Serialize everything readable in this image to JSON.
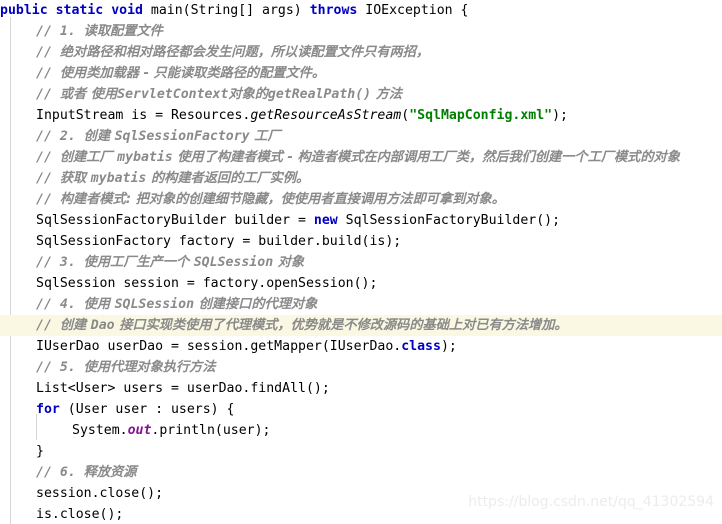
{
  "editor": {
    "background_color": "#ffffff",
    "highlight_line_color": "#faf8e3",
    "indent_guide_color": "#d6d6d6",
    "colors": {
      "keyword": "#0000c0",
      "string": "#008000",
      "comment": "#959595",
      "static_field": "#871094",
      "plain": "#000000"
    },
    "watermark": "https://blog.csdn.net/qq_41302594",
    "lines": [
      {
        "index": 1,
        "indent": 0,
        "highlighted": false,
        "text": "public static void main(String[] args) throws IOException {",
        "tokens": [
          {
            "t": "public",
            "k": "kw"
          },
          {
            "t": " ",
            "k": "pln"
          },
          {
            "t": "static",
            "k": "kw"
          },
          {
            "t": " ",
            "k": "pln"
          },
          {
            "t": "void",
            "k": "kw"
          },
          {
            "t": " main(String[] args) ",
            "k": "pln"
          },
          {
            "t": "throws",
            "k": "kw"
          },
          {
            "t": " IOException {",
            "k": "pln"
          }
        ]
      },
      {
        "index": 2,
        "indent": 1,
        "highlighted": false,
        "text": "// 1. 读取配置文件",
        "tokens": [
          {
            "t": "// 1. ",
            "k": "cmt-b"
          },
          {
            "t": "读取配置文件",
            "k": "cmt-cjk"
          }
        ]
      },
      {
        "index": 3,
        "indent": 1,
        "highlighted": false,
        "text": "// 绝对路径和相对路径都会发生问题，所以读配置文件只有两招，",
        "tokens": [
          {
            "t": "// ",
            "k": "cmt-b"
          },
          {
            "t": "绝对路径和相对路径都会发生问题，所以读配置文件只有两招，",
            "k": "cmt-cjk"
          }
        ]
      },
      {
        "index": 4,
        "indent": 1,
        "highlighted": false,
        "text": "// 使用类加载器 - 只能读取类路径的配置文件。",
        "tokens": [
          {
            "t": "// ",
            "k": "cmt-b"
          },
          {
            "t": "使用类加载器 - 只能读取类路径的配置文件。",
            "k": "cmt-cjk"
          }
        ]
      },
      {
        "index": 5,
        "indent": 1,
        "highlighted": false,
        "text": "// 或者 使用ServletContext对象的getRealPath() 方法",
        "tokens": [
          {
            "t": "// ",
            "k": "cmt-b"
          },
          {
            "t": "或者 使用",
            "k": "cmt-cjk"
          },
          {
            "t": "ServletContext",
            "k": "cmt-b"
          },
          {
            "t": "对象的",
            "k": "cmt-cjk"
          },
          {
            "t": "getRealPath()",
            "k": "cmt-b"
          },
          {
            "t": " 方法",
            "k": "cmt-cjk"
          }
        ]
      },
      {
        "index": 6,
        "indent": 1,
        "highlighted": false,
        "text": "InputStream is = Resources.getResourceAsStream(\"SqlMapConfig.xml\");",
        "tokens": [
          {
            "t": "InputStream is = Resources.",
            "k": "pln"
          },
          {
            "t": "getResourceAsStream",
            "k": "mth"
          },
          {
            "t": "(",
            "k": "pln"
          },
          {
            "t": "\"SqlMapConfig.xml\"",
            "k": "str"
          },
          {
            "t": ");",
            "k": "pln"
          }
        ]
      },
      {
        "index": 7,
        "indent": 1,
        "highlighted": false,
        "text": "// 2. 创建 SqlSessionFactory 工厂",
        "tokens": [
          {
            "t": "// 2. ",
            "k": "cmt-b"
          },
          {
            "t": "创建 ",
            "k": "cmt-cjk"
          },
          {
            "t": "SqlSessionFactory",
            "k": "cmt-b"
          },
          {
            "t": " 工厂",
            "k": "cmt-cjk"
          }
        ]
      },
      {
        "index": 8,
        "indent": 1,
        "highlighted": false,
        "text": "// 创建工厂 mybatis 使用了构建者模式 - 构造者模式在内部调用工厂类，然后我们创建一个工厂模式的对象",
        "tokens": [
          {
            "t": "// ",
            "k": "cmt-b"
          },
          {
            "t": "创建工厂 ",
            "k": "cmt-cjk"
          },
          {
            "t": "mybatis",
            "k": "cmt-b"
          },
          {
            "t": " 使用了构建者模式 - 构造者模式在内部调用工厂类，然后我们创建一个工厂模式的对象",
            "k": "cmt-cjk"
          }
        ]
      },
      {
        "index": 9,
        "indent": 1,
        "highlighted": false,
        "text": "// 获取 mybatis 的构建者返回的工厂实例。",
        "tokens": [
          {
            "t": "// ",
            "k": "cmt-b"
          },
          {
            "t": "获取 ",
            "k": "cmt-cjk"
          },
          {
            "t": "mybatis",
            "k": "cmt-b"
          },
          {
            "t": " 的构建者返回的工厂实例。",
            "k": "cmt-cjk"
          }
        ]
      },
      {
        "index": 10,
        "indent": 1,
        "highlighted": false,
        "text": "// 构建者模式: 把对象的创建细节隐藏，使使用者直接调用方法即可拿到对象。",
        "tokens": [
          {
            "t": "// ",
            "k": "cmt-b"
          },
          {
            "t": "构建者模式: 把对象的创建细节隐藏，使使用者直接调用方法即可拿到对象。",
            "k": "cmt-cjk"
          }
        ]
      },
      {
        "index": 11,
        "indent": 1,
        "highlighted": false,
        "text": "SqlSessionFactoryBuilder builder = new SqlSessionFactoryBuilder();",
        "tokens": [
          {
            "t": "SqlSessionFactoryBuilder builder = ",
            "k": "pln"
          },
          {
            "t": "new",
            "k": "kw"
          },
          {
            "t": " SqlSessionFactoryBuilder();",
            "k": "pln"
          }
        ]
      },
      {
        "index": 12,
        "indent": 1,
        "highlighted": false,
        "text": "SqlSessionFactory factory = builder.build(is);",
        "tokens": [
          {
            "t": "SqlSessionFactory factory = builder.build(is);",
            "k": "pln"
          }
        ]
      },
      {
        "index": 13,
        "indent": 1,
        "highlighted": false,
        "text": "// 3. 使用工厂生产一个 SQLSession 对象",
        "tokens": [
          {
            "t": "// 3. ",
            "k": "cmt-b"
          },
          {
            "t": "使用工厂生产一个 ",
            "k": "cmt-cjk"
          },
          {
            "t": "SQLSession",
            "k": "cmt-b"
          },
          {
            "t": " 对象",
            "k": "cmt-cjk"
          }
        ]
      },
      {
        "index": 14,
        "indent": 1,
        "highlighted": false,
        "text": "SqlSession session = factory.openSession();",
        "tokens": [
          {
            "t": "SqlSession session = factory.openSession();",
            "k": "pln"
          }
        ]
      },
      {
        "index": 15,
        "indent": 1,
        "highlighted": false,
        "text": "// 4. 使用 SQLSession 创建接口的代理对象",
        "tokens": [
          {
            "t": "// 4. ",
            "k": "cmt-b"
          },
          {
            "t": "使用 ",
            "k": "cmt-cjk"
          },
          {
            "t": "SQLSession",
            "k": "cmt-b"
          },
          {
            "t": " 创建接口的代理对象",
            "k": "cmt-cjk"
          }
        ]
      },
      {
        "index": 16,
        "indent": 1,
        "highlighted": true,
        "text": "// 创建 Dao 接口实现类使用了代理模式，优势就是不修改源码的基础上对已有方法增加。",
        "tokens": [
          {
            "t": "// ",
            "k": "cmt-b"
          },
          {
            "t": "创建 ",
            "k": "cmt-cjk"
          },
          {
            "t": "Dao",
            "k": "cmt-b"
          },
          {
            "t": " 接口实现类使用了代理模式，优势就是不修改源码的基础上对已有方法增加。",
            "k": "cmt-cjk"
          }
        ]
      },
      {
        "index": 17,
        "indent": 1,
        "highlighted": false,
        "text": "IUserDao userDao = session.getMapper(IUserDao.class);",
        "tokens": [
          {
            "t": "IUserDao userDao = session.getMapper(IUserDao.",
            "k": "pln"
          },
          {
            "t": "class",
            "k": "kw"
          },
          {
            "t": ");",
            "k": "pln"
          }
        ]
      },
      {
        "index": 18,
        "indent": 1,
        "highlighted": false,
        "text": "// 5. 使用代理对象执行方法",
        "tokens": [
          {
            "t": "// 5. ",
            "k": "cmt-b"
          },
          {
            "t": "使用代理对象执行方法",
            "k": "cmt-cjk"
          }
        ]
      },
      {
        "index": 19,
        "indent": 1,
        "highlighted": false,
        "text": "List<User> users = userDao.findAll();",
        "tokens": [
          {
            "t": "List<User> users = userDao.findAll();",
            "k": "pln"
          }
        ]
      },
      {
        "index": 20,
        "indent": 1,
        "highlighted": false,
        "text": "for (User user : users) {",
        "tokens": [
          {
            "t": "for",
            "k": "kw"
          },
          {
            "t": " (User user : users) {",
            "k": "pln"
          }
        ]
      },
      {
        "index": 21,
        "indent": 2,
        "highlighted": false,
        "text": "System.out.println(user);",
        "tokens": [
          {
            "t": "System.",
            "k": "pln"
          },
          {
            "t": "out",
            "k": "fld"
          },
          {
            "t": ".println(user);",
            "k": "pln"
          }
        ]
      },
      {
        "index": 22,
        "indent": 1,
        "highlighted": false,
        "text": "}",
        "tokens": [
          {
            "t": "}",
            "k": "pln"
          }
        ]
      },
      {
        "index": 23,
        "indent": 1,
        "highlighted": false,
        "text": "// 6. 释放资源",
        "tokens": [
          {
            "t": "// 6. ",
            "k": "cmt-b"
          },
          {
            "t": "释放资源",
            "k": "cmt-cjk"
          }
        ]
      },
      {
        "index": 24,
        "indent": 1,
        "highlighted": false,
        "text": "session.close();",
        "tokens": [
          {
            "t": "session.close();",
            "k": "pln"
          }
        ]
      },
      {
        "index": 25,
        "indent": 1,
        "highlighted": false,
        "text": "is.close();",
        "tokens": [
          {
            "t": "is.close();",
            "k": "pln"
          }
        ]
      }
    ]
  }
}
